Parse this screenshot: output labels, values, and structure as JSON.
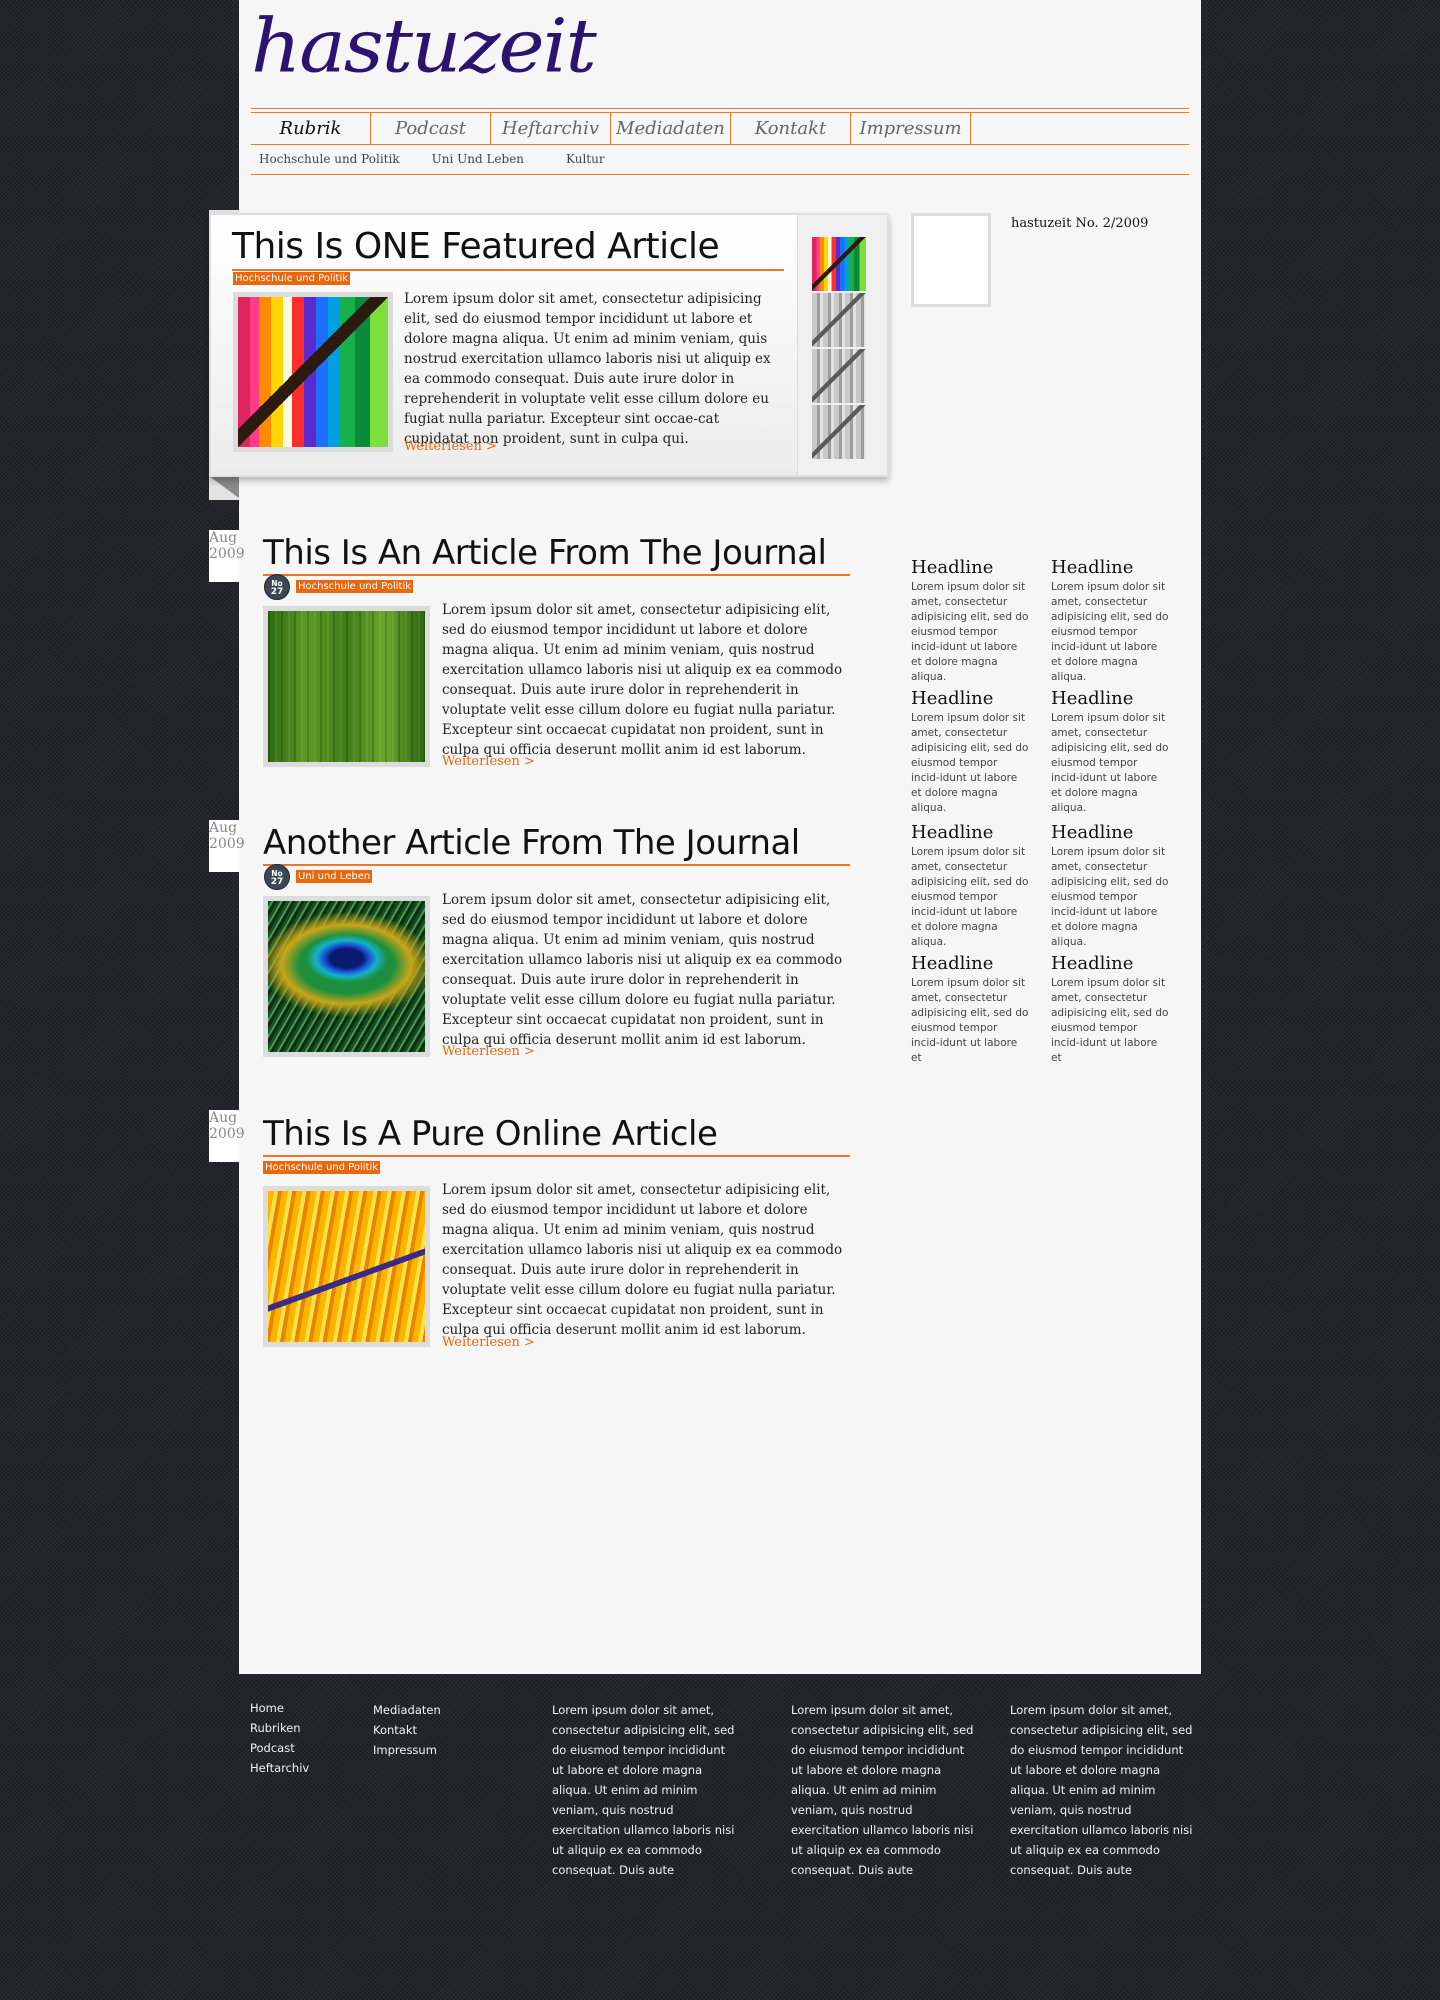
{
  "brand": {
    "logo": "hastuzeit",
    "accent": "#e8670f",
    "logo_color": "#2a1470"
  },
  "nav": {
    "items": [
      {
        "label": "Rubrik"
      },
      {
        "label": "Podcast"
      },
      {
        "label": "Heftarchiv"
      },
      {
        "label": "Mediadaten"
      },
      {
        "label": "Kontakt"
      },
      {
        "label": "Impressum"
      }
    ],
    "subitems": [
      {
        "label": "Hochschule und Politik"
      },
      {
        "label": "Uni Und Leben"
      },
      {
        "label": "Kultur"
      }
    ]
  },
  "featured": {
    "title": "This Is ONE Featured Article",
    "category": "Hochschule und Politik",
    "body": "Lorem ipsum dolor sit amet, consectetur adipisicing elit, sed do eiusmod tempor incididunt ut labore et dolore magna aliqua. Ut enim ad minim veniam, quis nostrud exercitation ullamco laboris nisi ut aliquip ex ea commodo consequat. Duis aute irure dolor in reprehenderit in voluptate velit esse cillum dolore eu fugiat nulla pariatur. Excepteur sint occae-cat cupidatat non proident, sunt in culpa qui.",
    "more": "Weiterlesen >"
  },
  "issue": {
    "label": "hastuzeit No. 2/2009"
  },
  "articles": [
    {
      "month": "Aug",
      "year": "2009",
      "title": "This Is An Article From The Journal",
      "seal_top": "No",
      "seal_num": "27",
      "category": "Hochschule und Politik",
      "body": "Lorem ipsum dolor sit amet, consectetur adipisicing elit, sed do eiusmod tempor incididunt ut labore et dolore magna aliqua. Ut enim ad minim veniam, quis nostrud exercitation ullamco laboris nisi ut aliquip ex ea commodo consequat. Duis aute irure dolor in reprehenderit in voluptate velit esse cillum dolore eu fugiat nulla pariatur. Excepteur sint occaecat cupidatat non proident, sunt in culpa qui officia deserunt mollit anim id est laborum.",
      "more": "Weiterlesen >"
    },
    {
      "month": "Aug",
      "year": "2009",
      "title": "Another Article From The Journal",
      "seal_top": "No",
      "seal_num": "27",
      "category": "Uni und Leben",
      "body": "Lorem ipsum dolor sit amet, consectetur adipisicing elit, sed do eiusmod tempor incididunt ut labore et dolore magna aliqua. Ut enim ad minim veniam, quis nostrud exercitation ullamco laboris nisi ut aliquip ex ea commodo consequat. Duis aute irure dolor in reprehenderit in voluptate velit esse cillum dolore eu fugiat nulla pariatur. Excepteur sint occaecat cupidatat non proident, sunt in culpa qui officia deserunt mollit anim id est laborum.",
      "more": "Weiterlesen >"
    },
    {
      "month": "Aug",
      "year": "2009",
      "title": "This Is A Pure Online Article",
      "category": "Hochschule und Politik",
      "body": "Lorem ipsum dolor sit amet, consectetur adipisicing elit, sed do eiusmod tempor incididunt ut labore et dolore magna aliqua. Ut enim ad minim veniam, quis nostrud exercitation ullamco laboris nisi ut aliquip ex ea commodo consequat. Duis aute irure dolor in reprehenderit in voluptate velit esse cillum dolore eu fugiat nulla pariatur. Excepteur sint occaecat cupidatat non proident, sunt in culpa qui officia deserunt mollit anim id est laborum.",
      "more": "Weiterlesen >"
    }
  ],
  "sidebar": {
    "headlines": [
      {
        "title": "Headline",
        "text": "Lorem ipsum dolor sit amet, consectetur adipisicing elit, sed do eiusmod tempor incid-idunt ut labore et dolore magna aliqua."
      },
      {
        "title": "Headline",
        "text": "Lorem ipsum dolor sit amet, consectetur adipisicing elit, sed do eiusmod tempor incid-idunt ut labore et dolore magna aliqua."
      },
      {
        "title": "Headline",
        "text": "Lorem ipsum dolor sit amet, consectetur adipisicing elit, sed do eiusmod tempor incid-idunt ut labore et dolore magna aliqua."
      },
      {
        "title": "Headline",
        "text": "Lorem ipsum dolor sit amet, consectetur adipisicing elit, sed do eiusmod tempor incid-idunt ut labore et dolore magna aliqua."
      },
      {
        "title": "Headline",
        "text": "Lorem ipsum dolor sit amet, consectetur adipisicing elit, sed do eiusmod tempor incid-idunt ut labore et dolore magna aliqua."
      },
      {
        "title": "Headline",
        "text": "Lorem ipsum dolor sit amet, consectetur adipisicing elit, sed do eiusmod tempor incid-idunt ut labore et dolore magna aliqua."
      },
      {
        "title": "Headline",
        "text": "Lorem ipsum dolor sit amet, consectetur adipisicing elit, sed do eiusmod tempor incid-idunt ut labore et"
      },
      {
        "title": "Headline",
        "text": "Lorem ipsum dolor sit amet, consectetur adipisicing elit, sed do eiusmod tempor incid-idunt ut labore et"
      }
    ]
  },
  "footer": {
    "col1": [
      "Home",
      "Rubriken",
      "Podcast",
      "Heftarchiv"
    ],
    "col2": [
      "Mediadaten",
      "Kontakt",
      "Impressum"
    ],
    "text1": "Lorem ipsum dolor sit amet, consectetur adipisicing elit, sed do eiusmod tempor incididunt ut labore et dolore magna aliqua. Ut enim ad minim veniam, quis nostrud exercitation ullamco laboris nisi ut aliquip ex ea commodo consequat. Duis aute",
    "text2": "Lorem ipsum dolor sit amet, consectetur adipisicing elit, sed do eiusmod tempor incididunt ut labore et dolore magna aliqua. Ut enim ad minim veniam, quis nostrud exercitation ullamco laboris nisi ut aliquip ex ea commodo consequat. Duis aute",
    "text3": "Lorem ipsum dolor sit amet, consectetur adipisicing elit, sed do eiusmod tempor incididunt ut labore et dolore magna aliqua. Ut enim ad minim veniam, quis nostrud exercitation ullamco laboris nisi ut aliquip ex ea commodo consequat. Duis aute"
  }
}
